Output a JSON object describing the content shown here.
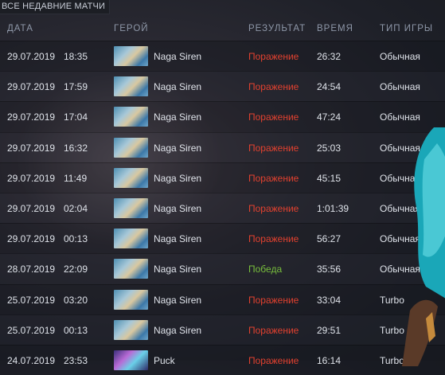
{
  "panel": {
    "title": "ВСЕ НЕДАВНИЕ МАТЧИ"
  },
  "columns": {
    "date": "ДАТА",
    "hero": "ГЕРОЙ",
    "result": "РЕЗУЛЬТАТ",
    "duration": "ВРЕМЯ",
    "mode": "ТИП ИГРЫ"
  },
  "matches": [
    {
      "date": "29.07.2019",
      "time": "18:35",
      "hero": "Naga Siren",
      "hero_icon": "naga-siren-portrait",
      "result": "Поражение",
      "outcome": "loss",
      "duration": "26:32",
      "mode": "Обычная"
    },
    {
      "date": "29.07.2019",
      "time": "17:59",
      "hero": "Naga Siren",
      "hero_icon": "naga-siren-portrait",
      "result": "Поражение",
      "outcome": "loss",
      "duration": "24:54",
      "mode": "Обычная"
    },
    {
      "date": "29.07.2019",
      "time": "17:04",
      "hero": "Naga Siren",
      "hero_icon": "naga-siren-portrait",
      "result": "Поражение",
      "outcome": "loss",
      "duration": "47:24",
      "mode": "Обычная"
    },
    {
      "date": "29.07.2019",
      "time": "16:32",
      "hero": "Naga Siren",
      "hero_icon": "naga-siren-portrait",
      "result": "Поражение",
      "outcome": "loss",
      "duration": "25:03",
      "mode": "Обычная"
    },
    {
      "date": "29.07.2019",
      "time": "11:49",
      "hero": "Naga Siren",
      "hero_icon": "naga-siren-portrait",
      "result": "Поражение",
      "outcome": "loss",
      "duration": "45:15",
      "mode": "Обычная"
    },
    {
      "date": "29.07.2019",
      "time": "02:04",
      "hero": "Naga Siren",
      "hero_icon": "naga-siren-portrait",
      "result": "Поражение",
      "outcome": "loss",
      "duration": "1:01:39",
      "mode": "Обычная"
    },
    {
      "date": "29.07.2019",
      "time": "00:13",
      "hero": "Naga Siren",
      "hero_icon": "naga-siren-portrait",
      "result": "Поражение",
      "outcome": "loss",
      "duration": "56:27",
      "mode": "Обычная"
    },
    {
      "date": "28.07.2019",
      "time": "22:09",
      "hero": "Naga Siren",
      "hero_icon": "naga-siren-portrait",
      "result": "Победа",
      "outcome": "win",
      "duration": "35:56",
      "mode": "Обычная"
    },
    {
      "date": "25.07.2019",
      "time": "03:20",
      "hero": "Naga Siren",
      "hero_icon": "naga-siren-portrait",
      "result": "Поражение",
      "outcome": "loss",
      "duration": "33:04",
      "mode": "Turbo"
    },
    {
      "date": "25.07.2019",
      "time": "00:13",
      "hero": "Naga Siren",
      "hero_icon": "naga-siren-portrait",
      "result": "Поражение",
      "outcome": "loss",
      "duration": "29:51",
      "mode": "Turbo"
    },
    {
      "date": "24.07.2019",
      "time": "23:53",
      "hero": "Puck",
      "hero_icon": "puck-portrait",
      "result": "Поражение",
      "outcome": "loss",
      "duration": "16:14",
      "mode": "Turbo"
    }
  ],
  "colors": {
    "loss": "#e2412f",
    "win": "#78bf3c",
    "header": "#8e97a8"
  }
}
